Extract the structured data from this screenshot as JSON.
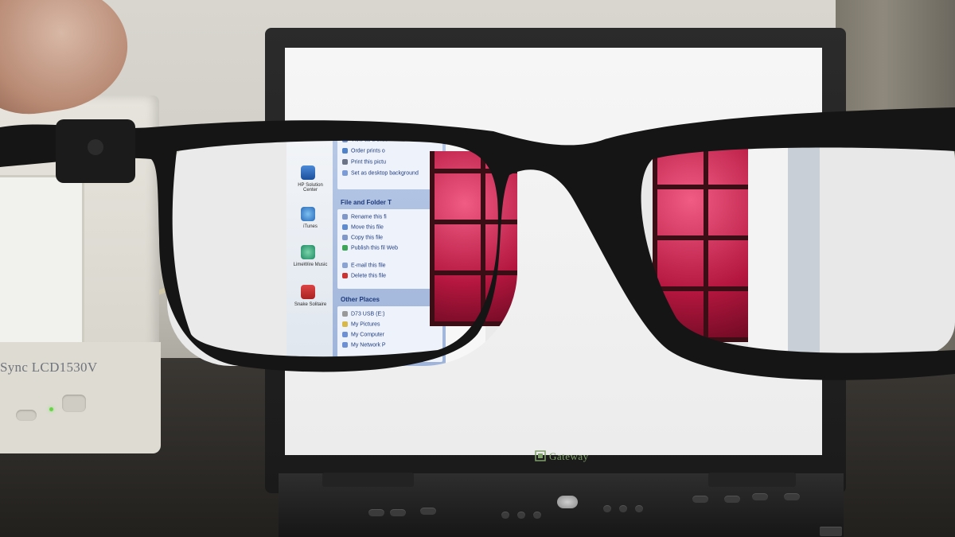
{
  "monitor": {
    "brand_text": "Sync LCD1530V"
  },
  "laptop": {
    "logo_text": "Gateway"
  },
  "explorer": {
    "desktop_icons": [
      {
        "label": "HP Solution Center"
      },
      {
        "label": "iTunes"
      },
      {
        "label": "LimeWire Music"
      },
      {
        "label": "Snake Solitaire"
      }
    ],
    "picture_tasks": [
      "View as a slide",
      "Order prints o",
      "Print this pictu",
      "Set as desktop background"
    ],
    "file_folder_panel": {
      "title": "File and Folder T",
      "items": [
        "Rename this fi",
        "Move this file",
        "Copy this file",
        "Publish this fil Web",
        "E-mail this file",
        "Delete this file"
      ]
    },
    "other_places_panel": {
      "title": "Other Places",
      "items": [
        "D73 USB (E:)",
        "My Pictures",
        "My Computer",
        "My Network P"
      ]
    }
  },
  "colors": {
    "glasses_frame": "#151515",
    "red_wall": "#d0234f",
    "xp_blue": "#9fb4da"
  }
}
